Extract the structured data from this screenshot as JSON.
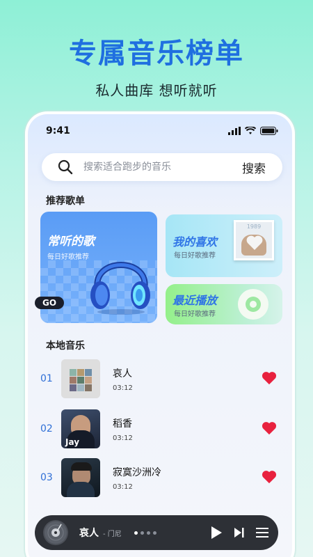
{
  "promo": {
    "title": "专属音乐榜单",
    "subtitle": "私人曲库 想听就听"
  },
  "status_bar": {
    "time": "9:41"
  },
  "search": {
    "placeholder": "搜索适合跑步的音乐",
    "button_label": "搜索"
  },
  "recommend": {
    "section_title": "推荐歌单",
    "big_card": {
      "title": "常听的歌",
      "subtitle": "每日好歌推荐",
      "go_label": "GO"
    },
    "fav_card": {
      "title": "我的喜欢",
      "subtitle": "每日好歌推荐",
      "cover_text": "1989"
    },
    "recent_card": {
      "title": "最近播放",
      "subtitle": "每日好歌推荐"
    }
  },
  "local": {
    "section_title": "本地音乐",
    "songs": [
      {
        "index": "01",
        "title": "哀人",
        "duration": "03:12"
      },
      {
        "index": "02",
        "title": "稻香",
        "duration": "03:12",
        "cover_text": "Jay"
      },
      {
        "index": "03",
        "title": "寂寞沙洲冷",
        "duration": "03:12"
      }
    ]
  },
  "player": {
    "song": "哀人",
    "artist": "- 门尼"
  },
  "colors": {
    "accent": "#1f6fe0",
    "heart": "#e8213e",
    "player_bg": "#2d3036"
  }
}
